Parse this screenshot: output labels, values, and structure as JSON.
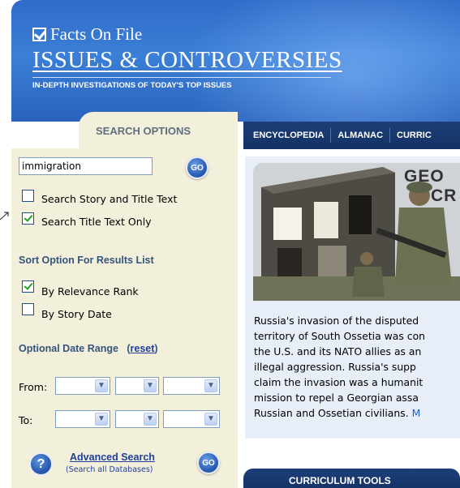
{
  "header": {
    "brand": "Facts On File",
    "title": "ISSUES & CONTROVERSIES",
    "tagline": "IN-DEPTH INVESTIGATIONS OF TODAY'S TOP ISSUES"
  },
  "search": {
    "tab_label": "SEARCH OPTIONS",
    "query": "immigration",
    "go_label": "GO",
    "scope_options": [
      {
        "label": "Search Story and Title Text",
        "checked": false
      },
      {
        "label": "Search Title Text Only",
        "checked": true
      }
    ],
    "sort_heading": "Sort Option For Results List",
    "sort_options": [
      {
        "label": "By Relevance Rank",
        "checked": true
      },
      {
        "label": "By Story Date",
        "checked": false
      }
    ],
    "date_heading": "Optional Date Range",
    "reset_label": "reset",
    "from_label": "From:",
    "to_label": "To:",
    "advanced_link": "Advanced Search",
    "advanced_sub": "(Search all Databases)",
    "advanced_go_label": "GO"
  },
  "nav": {
    "items": [
      "ENCYCLOPEDIA",
      "ALMANAC",
      "CURRIC"
    ]
  },
  "feature": {
    "headline_1": "GEO",
    "headline_2": "CR",
    "story_lines": [
      "Russia's invasion of the disputed",
      "territory of South Ossetia was con",
      "the U.S. and its NATO allies as an",
      "illegal aggression. Russia's supp",
      "claim the invasion was a humanit",
      "mission to repel a Georgian assa",
      "Russian and Ossetian civilians."
    ],
    "more_label": "M"
  },
  "curriculum": {
    "label": "CURRICULUM TOOLS"
  },
  "colors": {
    "banner_blue": "#2f6bc8",
    "panel_tan": "#f2efdb",
    "nav_navy": "#1c3e78",
    "link_blue": "#1f3f99"
  }
}
